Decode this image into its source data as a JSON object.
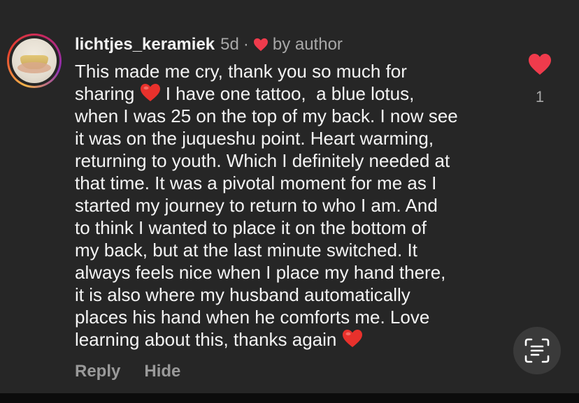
{
  "comment": {
    "username": "lichtjes_keramiek",
    "time_ago": "5d",
    "separator": "·",
    "liked_by_author_label": "by author",
    "text_lines": [
      "This made me cry, thank you so much for",
      "sharing ",
      " I have one tattoo,  a blue lotus,",
      "when I was 25 on the top of my back. I now see",
      "it was on the juqueshu point. Heart warming,",
      "returning to youth. Which I definitely needed at",
      "that time. It was a pivotal moment for me as I",
      "started my journey to return to who I am. And",
      "to think I wanted to place it on the bottom of",
      "my back, but at the last minute switched. It",
      "always feels nice when I place my hand there,",
      "it is also where my husband automatically",
      "places his hand when he comforts me. Love",
      "learning about this, thanks again "
    ],
    "like_count": "1"
  },
  "actions": {
    "reply_label": "Reply",
    "hide_label": "Hide"
  },
  "icons": {
    "avatar": "profile-avatar",
    "like": "heart-icon",
    "emoji": "red-heart-emoji",
    "scan": "scan-text-icon"
  },
  "colors": {
    "background": "#262626",
    "heart_red": "#ef3b4c",
    "text_primary": "#f4f4f4",
    "text_secondary": "#a8a8a8"
  }
}
